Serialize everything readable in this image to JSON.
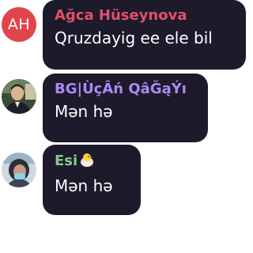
{
  "messages": [
    {
      "avatar": {
        "type": "initials",
        "initials": "AH",
        "color": "#e0454d"
      },
      "sender": "Ağca Hüseynova",
      "sender_color": "#e0516a",
      "text": "Qruzdayig ee ele bil"
    },
    {
      "avatar": {
        "type": "photo",
        "icon": "user-photo-avatar"
      },
      "sender": "BG|ÙçÂń QâĞąÝı",
      "sender_color": "#a98bf2",
      "text": "Mən hə"
    },
    {
      "avatar": {
        "type": "photo",
        "icon": "user-photo-avatar"
      },
      "sender": "Esi",
      "sender_emoji": "hatching-chick-icon",
      "sender_color": "#7fcc8a",
      "text": "Mən hə"
    }
  ]
}
